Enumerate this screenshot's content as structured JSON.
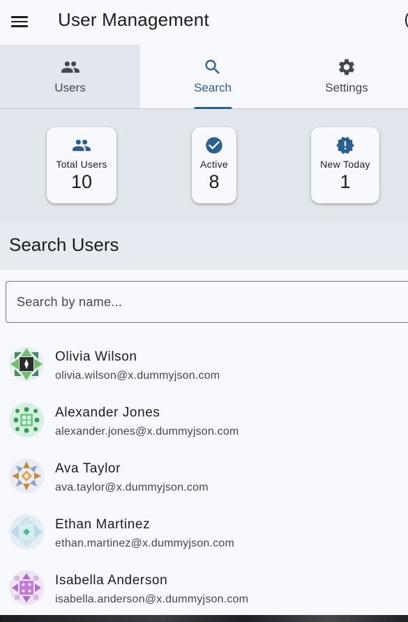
{
  "app": {
    "title": "User Management"
  },
  "icons": {
    "menu": "menu-icon",
    "users": "people-icon",
    "search": "search-icon",
    "settings": "gear-icon",
    "active": "check-circle-icon",
    "new_today": "new-badge-icon"
  },
  "colors": {
    "accent": "#2a5f8f",
    "icon": "#43474e",
    "stats_background": "#e1e5ec",
    "selected_tab_background": "#e3e6ee"
  },
  "tabs": [
    {
      "label": "Users",
      "icon": "people-icon",
      "active": false
    },
    {
      "label": "Search",
      "icon": "search-icon",
      "active": true
    },
    {
      "label": "Settings",
      "icon": "gear-icon",
      "active": false
    }
  ],
  "stats": [
    {
      "label": "Total Users",
      "value": "10",
      "icon": "people-icon"
    },
    {
      "label": "Active",
      "value": "8",
      "icon": "check-circle-icon"
    },
    {
      "label": "New Today",
      "value": "1",
      "icon": "new-badge-icon"
    }
  ],
  "search_section": {
    "title": "Search Users",
    "placeholder": "Search by name...",
    "value": ""
  },
  "users": [
    {
      "name": "Olivia Wilson",
      "email": "olivia.wilson@x.dummyjson.com",
      "avatar": "identicon-avatar"
    },
    {
      "name": "Alexander Jones",
      "email": "alexander.jones@x.dummyjson.com",
      "avatar": "identicon-avatar"
    },
    {
      "name": "Ava Taylor",
      "email": "ava.taylor@x.dummyjson.com",
      "avatar": "identicon-avatar"
    },
    {
      "name": "Ethan Martinez",
      "email": "ethan.martinez@x.dummyjson.com",
      "avatar": "identicon-avatar"
    },
    {
      "name": "Isabella Anderson",
      "email": "isabella.anderson@x.dummyjson.com",
      "avatar": "identicon-avatar"
    }
  ]
}
